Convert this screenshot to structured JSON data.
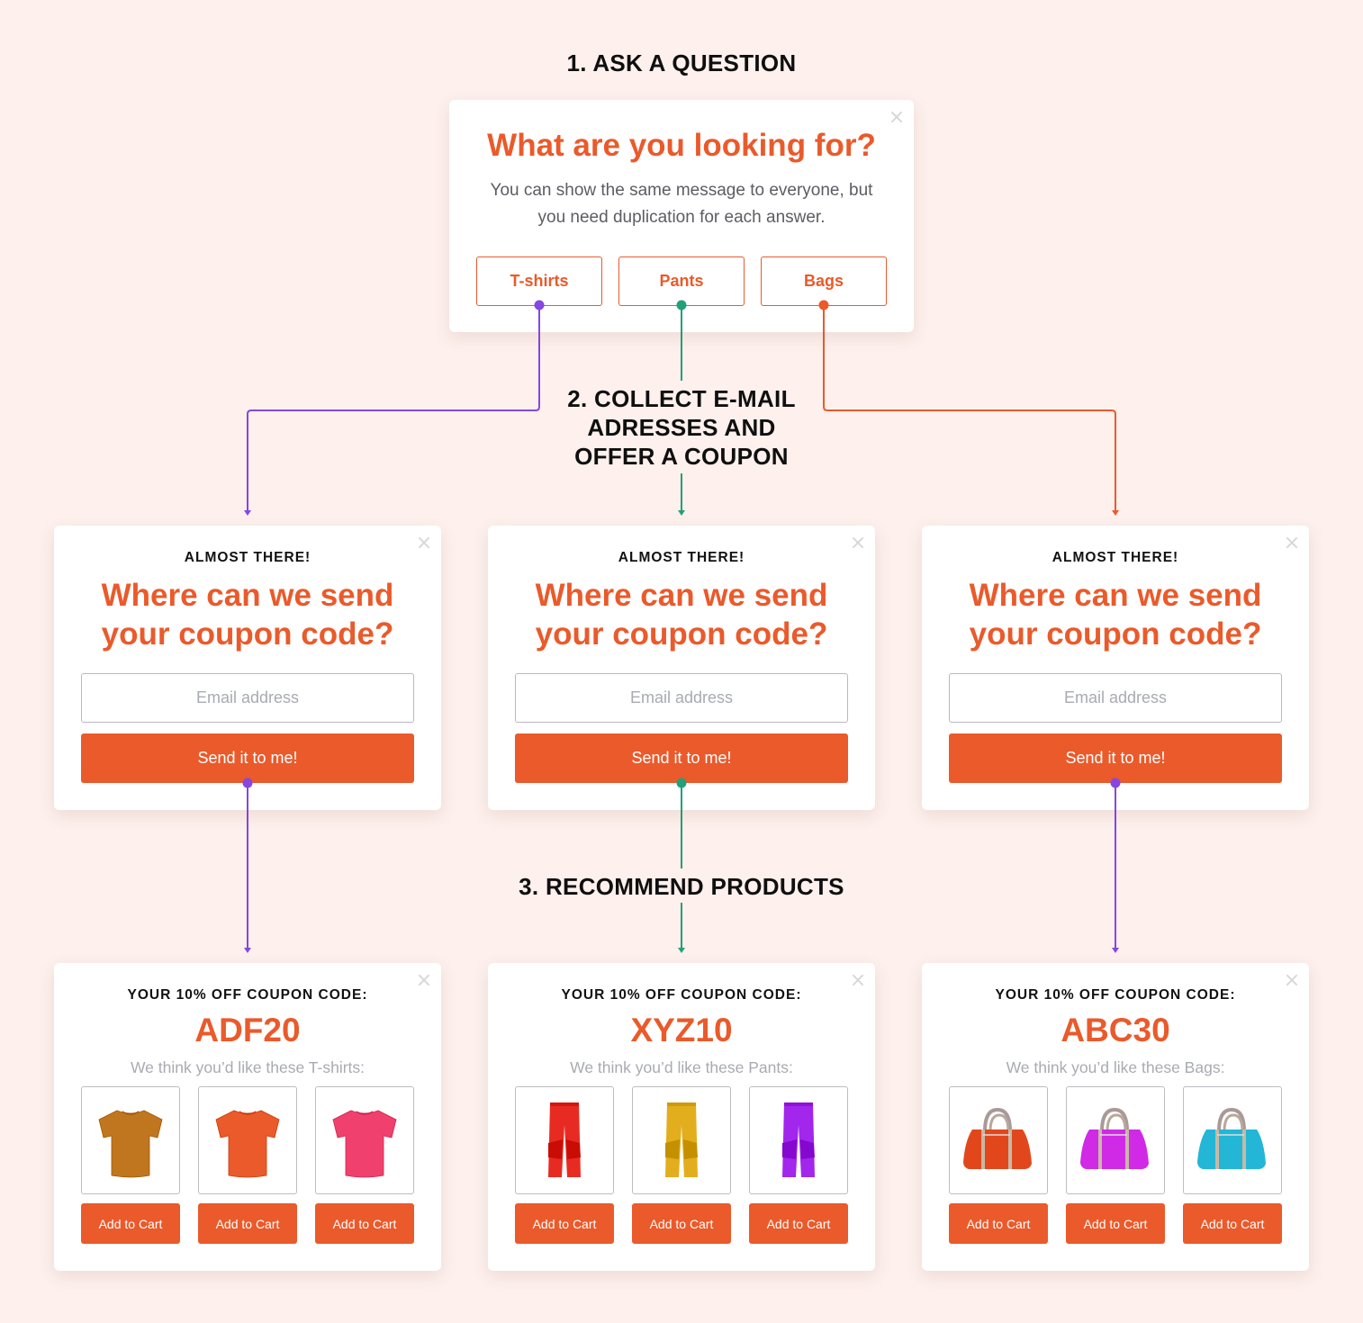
{
  "steps": {
    "step1": "1. ASK A QUESTION",
    "step2_lines": [
      "2. COLLECT E-MAIL",
      "ADRESSES AND",
      "OFFER A COUPON"
    ],
    "step3": "3. RECOMMEND PRODUCTS"
  },
  "colors": {
    "accent": "#ea5a2b",
    "tshirts_path": "#8447e2",
    "pants_path": "#21a07a",
    "bags_path": "#ea5a2b",
    "background": "#fdf0ed"
  },
  "question_card": {
    "title": "What are you looking for?",
    "subtitle": "You can show the same message to everyone, but you need duplication for each answer.",
    "answers": [
      {
        "label": "T-shirts"
      },
      {
        "label": "Pants"
      },
      {
        "label": "Bags"
      }
    ],
    "close_icon": "close-icon"
  },
  "email_cards": [
    {
      "eyebrow": "ALMOST THERE!",
      "title_line1": "Where can we send",
      "title_line2": "your coupon code?",
      "email_placeholder": "Email address",
      "email_value": "",
      "button": "Send it to me!"
    },
    {
      "eyebrow": "ALMOST THERE!",
      "title_line1": "Where can we send",
      "title_line2": "your coupon code?",
      "email_placeholder": "Email address",
      "email_value": "",
      "button": "Send it to me!"
    },
    {
      "eyebrow": "ALMOST THERE!",
      "title_line1": "Where can we send",
      "title_line2": "your coupon code?",
      "email_placeholder": "Email address",
      "email_value": "",
      "button": "Send it to me!"
    }
  ],
  "product_cards": [
    {
      "coupon_label": "YOUR 10% OFF COUPON CODE:",
      "code": "ADF20",
      "recommend": "We think you’d like these T-shirts:",
      "product_type": "tshirt",
      "products": [
        {
          "color": "#c0761f",
          "button": "Add to Cart"
        },
        {
          "color": "#ea5a2b",
          "button": "Add to Cart"
        },
        {
          "color": "#f0416e",
          "button": "Add to Cart"
        }
      ]
    },
    {
      "coupon_label": "YOUR 10% OFF COUPON CODE:",
      "code": "XYZ10",
      "recommend": "We think you’d like these Pants:",
      "product_type": "pants",
      "products": [
        {
          "color": "#e82b22",
          "button": "Add to Cart"
        },
        {
          "color": "#e2ae1e",
          "button": "Add to Cart"
        },
        {
          "color": "#a226ec",
          "button": "Add to Cart"
        }
      ]
    },
    {
      "coupon_label": "YOUR 10% OFF COUPON CODE:",
      "code": "ABC30",
      "recommend": "We think you’d like these Bags:",
      "product_type": "bag",
      "products": [
        {
          "color": "#e2471c",
          "button": "Add to Cart"
        },
        {
          "color": "#d02ae6",
          "button": "Add to Cart"
        },
        {
          "color": "#23b6d6",
          "button": "Add to Cart"
        }
      ]
    }
  ]
}
